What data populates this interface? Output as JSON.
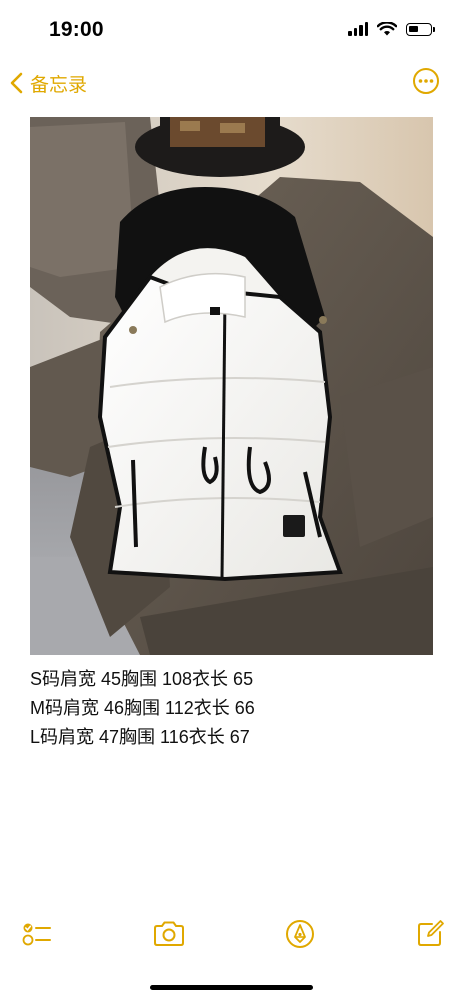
{
  "status_bar": {
    "time": "19:00",
    "signal_icon": "cellular-signal-icon",
    "wifi_icon": "wifi-icon",
    "battery_icon": "battery-icon",
    "battery_level": 0.45
  },
  "nav": {
    "back_label": "备忘录",
    "back_icon": "chevron-left-icon",
    "more_icon": "ellipsis-circle-icon",
    "accent_color": "#e0a800"
  },
  "photo": {
    "subject": "white-black-trim-hooded-puffer-vest"
  },
  "note": {
    "lines": [
      "S码肩宽 45胸围 108衣长 65",
      "M码肩宽 46胸围 112衣长 66",
      "L码肩宽 47胸围 116衣长 67"
    ]
  },
  "toolbar": {
    "checklist_icon": "checklist-icon",
    "camera_icon": "camera-icon",
    "markup_icon": "pen-tip-icon",
    "compose_icon": "compose-icon"
  }
}
